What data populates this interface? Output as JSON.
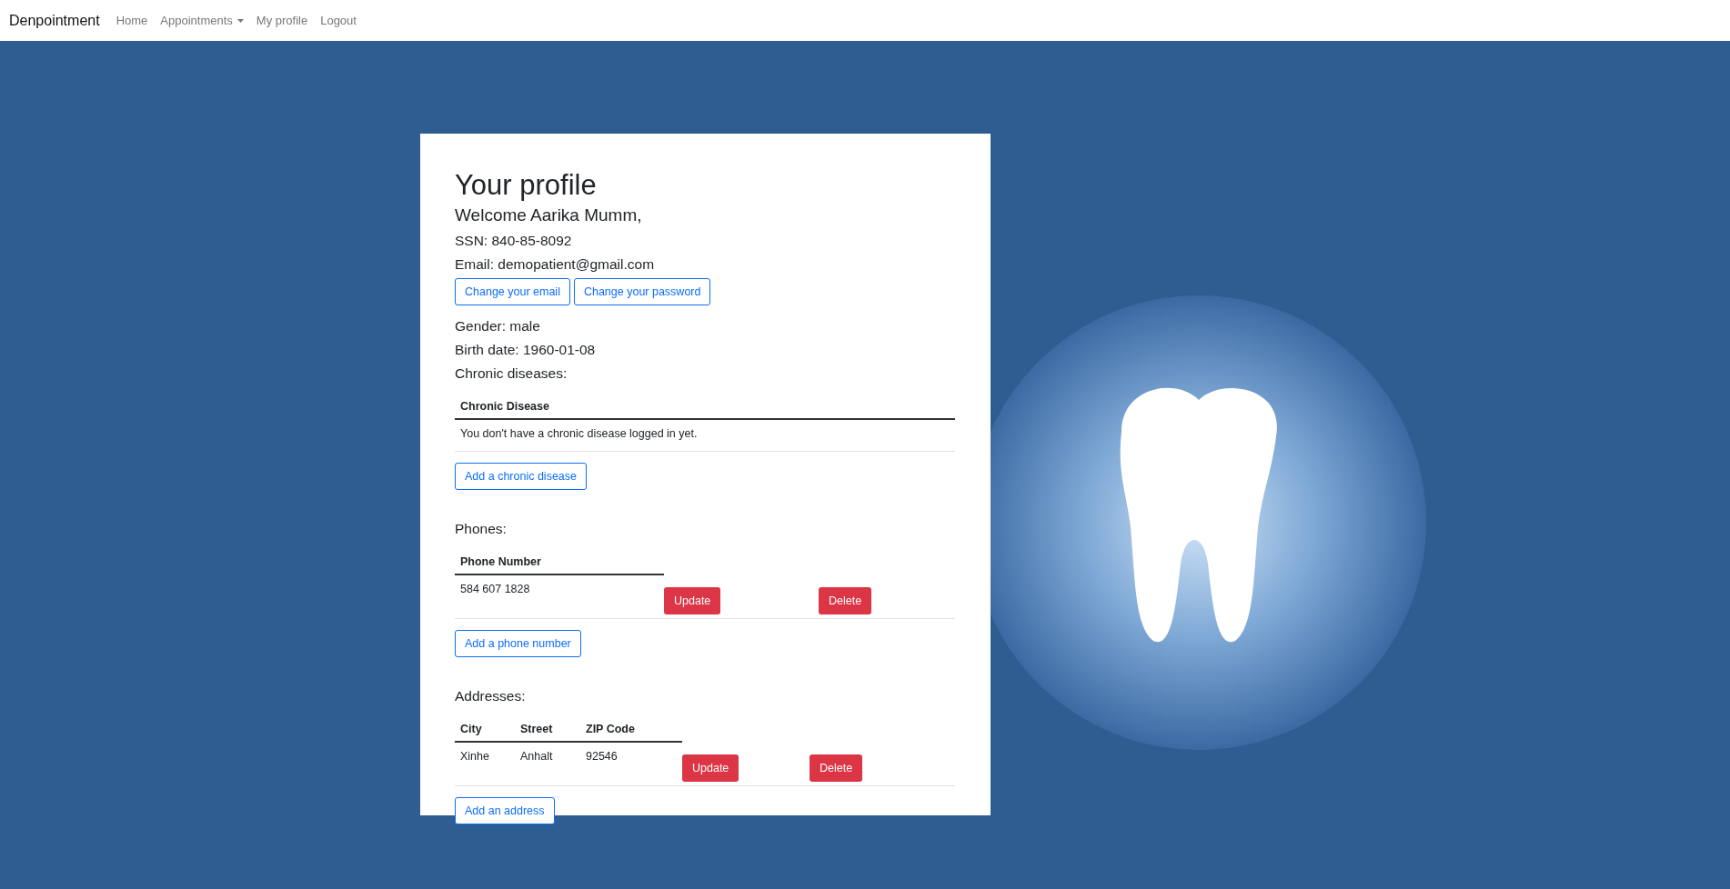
{
  "navbar": {
    "brand": "Denpointment",
    "links": [
      {
        "label": "Home",
        "kind": "link"
      },
      {
        "label": "Appointments",
        "kind": "dropdown"
      },
      {
        "label": "My profile",
        "kind": "link"
      },
      {
        "label": "Logout",
        "kind": "link"
      }
    ]
  },
  "profile": {
    "title": "Your profile",
    "welcome": "Welcome Aarika Mumm,",
    "ssn": "SSN: 840-85-8092",
    "email": "Email: demopatient@gmail.com",
    "account_buttons": [
      "Change your email",
      "Change your password"
    ],
    "gender": "Gender: male",
    "birth_date": "Birth date: 1960-01-08"
  },
  "chronic_diseases": {
    "heading": "Chronic diseases:",
    "columns": [
      "Chronic Disease"
    ],
    "empty_message": "You don't have a chronic disease logged in yet.",
    "add_button": "Add a chronic disease"
  },
  "phones": {
    "heading": "Phones:",
    "columns": [
      "Phone Number"
    ],
    "rows": [
      {
        "cells": [
          "584 607 1828"
        ],
        "update": "Update",
        "delete": "Delete"
      }
    ],
    "add_button": "Add a phone number"
  },
  "addresses": {
    "heading": "Addresses:",
    "columns": [
      "City",
      "Street",
      "ZIP Code"
    ],
    "rows": [
      {
        "cells": [
          "Xinhe",
          "Anhalt",
          "92546"
        ],
        "update": "Update",
        "delete": "Delete"
      }
    ],
    "add_button": "Add an address"
  }
}
